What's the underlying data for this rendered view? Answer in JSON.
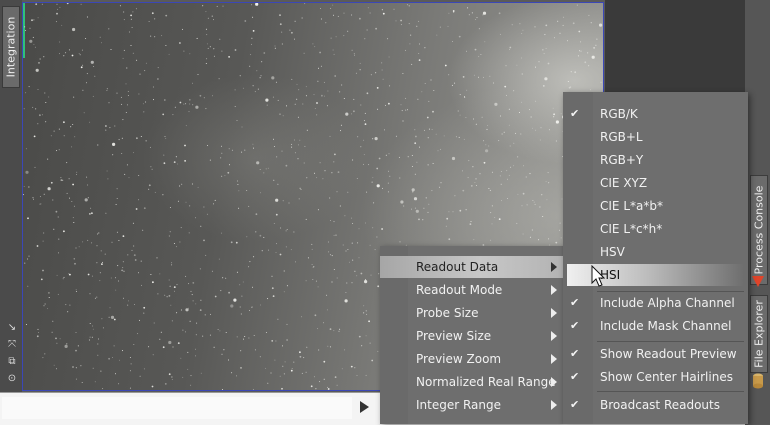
{
  "left_panel": {
    "tab_label": "Integration",
    "tools": [
      "zoom-arrow-icon",
      "fit-view-icon",
      "duplicate-icon",
      "target-icon"
    ]
  },
  "right_panel": {
    "process_console_label": "Process Console",
    "file_explorer_label": "File Explorer"
  },
  "context_menu": {
    "items": [
      {
        "label": "Readout Data",
        "has_submenu": true,
        "highlighted": true
      },
      {
        "label": "Readout Mode",
        "has_submenu": true
      },
      {
        "label": "Probe Size",
        "has_submenu": true
      },
      {
        "label": "Preview Size",
        "has_submenu": true
      },
      {
        "label": "Preview Zoom",
        "has_submenu": true
      },
      {
        "label": "Normalized Real Range",
        "has_submenu": true
      },
      {
        "label": "Integer Range",
        "has_submenu": true
      }
    ]
  },
  "submenu": {
    "items": [
      {
        "label": "RGB/K",
        "checked": true
      },
      {
        "label": "RGB+L",
        "checked": false
      },
      {
        "label": "RGB+Y",
        "checked": false
      },
      {
        "label": "CIE XYZ",
        "checked": false
      },
      {
        "label": "CIE L*a*b*",
        "checked": false
      },
      {
        "label": "CIE L*c*h*",
        "checked": false
      },
      {
        "label": "HSV",
        "checked": false
      },
      {
        "label": "HSI",
        "checked": false,
        "highlighted": true
      },
      {
        "label": "Include Alpha Channel",
        "checked": true
      },
      {
        "label": "Include Mask Channel",
        "checked": true
      },
      {
        "label": "Show Readout Preview",
        "checked": true
      },
      {
        "label": "Show Center Hairlines",
        "checked": true
      },
      {
        "label": "Broadcast Readouts",
        "checked": true
      }
    ]
  },
  "check_glyph": "✔",
  "colors": {
    "view_border": "#3b47b6",
    "edge_marker": "#2ec27a",
    "accent_icon": "#e0442a"
  }
}
